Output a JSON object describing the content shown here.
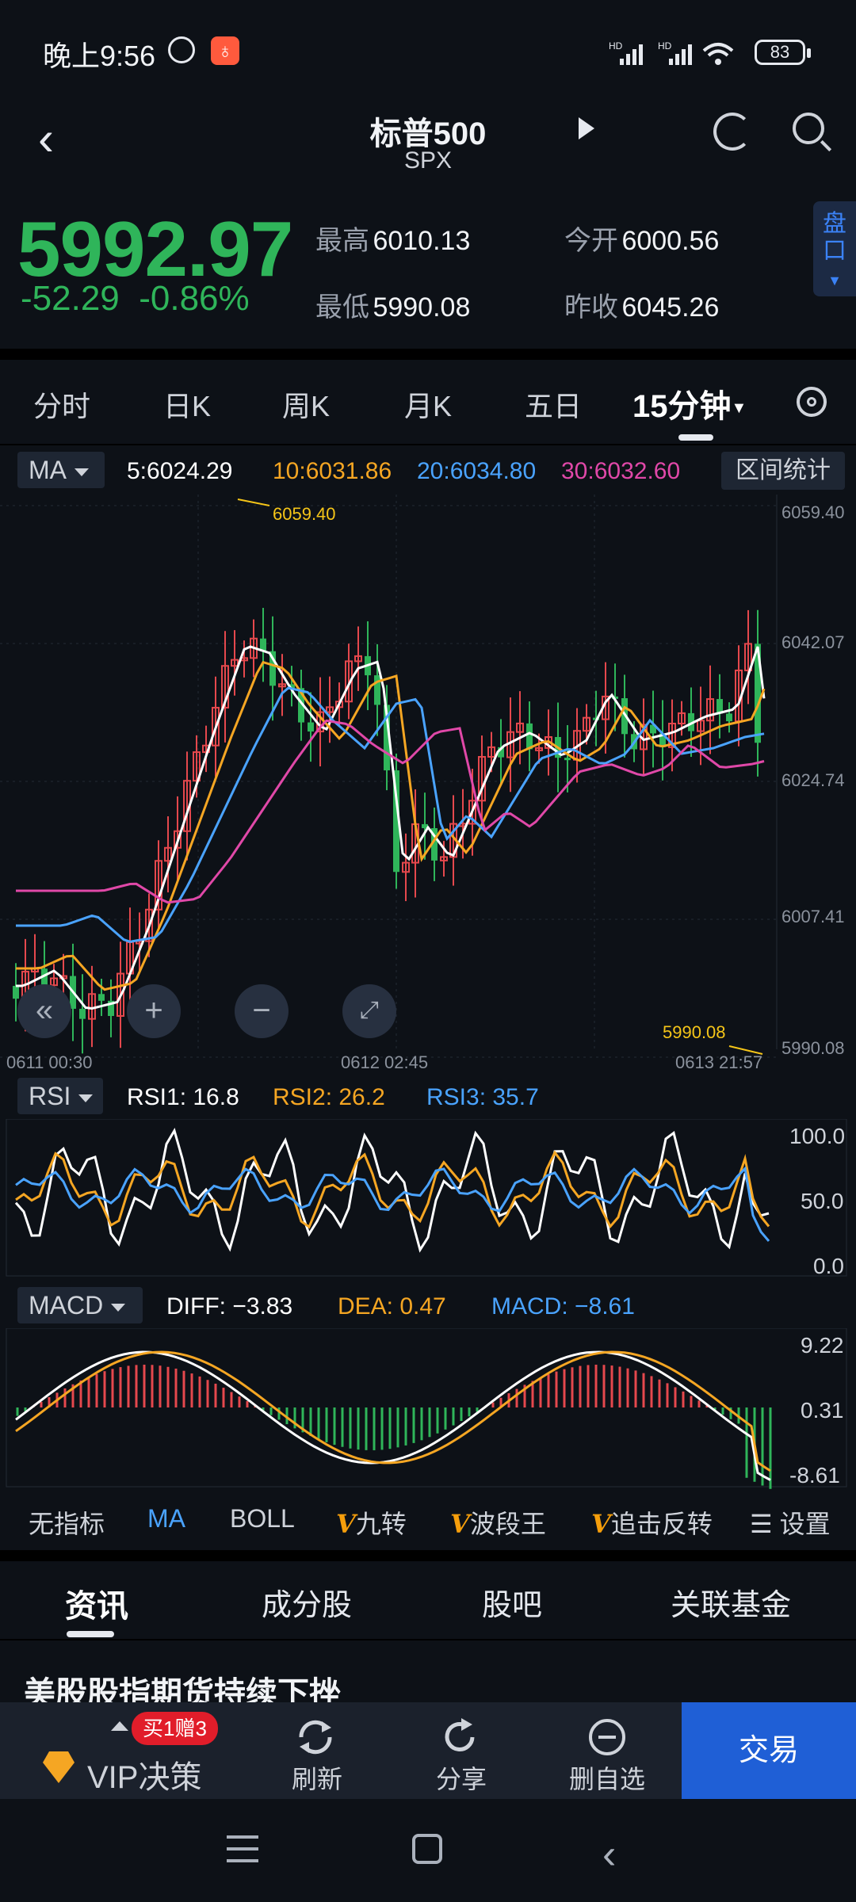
{
  "status_bar": {
    "time": "晚上9:56",
    "signal1": "HD",
    "signal2": "HD",
    "battery": "83"
  },
  "header": {
    "title": "标普500",
    "subtitle": "SPX"
  },
  "quote": {
    "price": "5992.97",
    "change": "-52.29",
    "change_pct": "-0.86%",
    "high_label": "最高",
    "high": "6010.13",
    "open_label": "今开",
    "open": "6000.56",
    "low_label": "最低",
    "low": "5990.08",
    "prev_close_label": "昨收",
    "prev_close": "6045.26",
    "side_tab": "盘口"
  },
  "period_tabs": [
    {
      "label": "分时"
    },
    {
      "label": "日K"
    },
    {
      "label": "周K"
    },
    {
      "label": "月K"
    },
    {
      "label": "五日"
    },
    {
      "label": "15分钟",
      "active": true
    }
  ],
  "ma_row": {
    "selector": "MA",
    "ma5": "5:6024.29",
    "ma10": "10:6031.86",
    "ma20": "20:6034.80",
    "ma30": "30:6032.60",
    "range_button": "区间统计"
  },
  "main_chart": {
    "y_labels": [
      "6059.40",
      "6042.07",
      "6024.74",
      "6007.41",
      "5990.08"
    ],
    "high_marker": "6059.40",
    "low_marker": "5990.08",
    "x_labels": [
      "0611  00:30",
      "0612  02:45",
      "0613  21:57"
    ]
  },
  "rsi_row": {
    "selector": "RSI",
    "rsi1": "RSI1:  16.8",
    "rsi2": "RSI2:  26.2",
    "rsi3": "RSI3:  35.7",
    "y_labels": [
      "100.0",
      "50.0",
      "0.0"
    ]
  },
  "macd_row": {
    "selector": "MACD",
    "diff": "DIFF:  −3.83",
    "dea": "DEA:  0.47",
    "macd": "MACD:  −8.61",
    "y_labels": [
      "9.22",
      "0.31",
      "-8.61"
    ]
  },
  "indicator_bar": {
    "none": "无指标",
    "ma": "MA",
    "boll": "BOLL",
    "v1": "九转",
    "v2": "波段王",
    "v3": "追击反转",
    "settings": "设置"
  },
  "news_tabs": [
    "资讯",
    "成分股",
    "股吧",
    "关联基金"
  ],
  "headline": "美股股指期货持续下挫",
  "action_bar": {
    "promo": "买1赠3",
    "vip": "VIP决策",
    "refresh": "刷新",
    "share": "分享",
    "remove": "删自选",
    "trade": "交易"
  },
  "colors": {
    "up": "#e5484d",
    "down": "#2fb55a",
    "ma5": "#ffffff",
    "ma10": "#f5a623",
    "ma20": "#4aa3ff",
    "ma30": "#e048a8"
  }
}
